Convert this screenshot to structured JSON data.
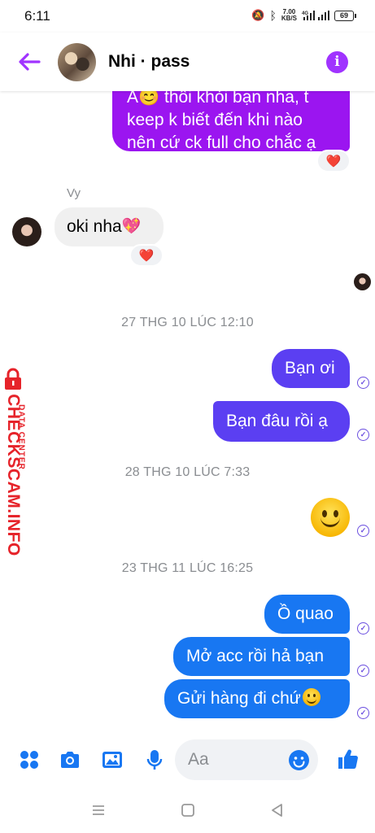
{
  "status_bar": {
    "time": "6:11",
    "speed_value": "7.00",
    "speed_unit": "KB/S",
    "battery": "69"
  },
  "header": {
    "contact_name": "Nhi · pass"
  },
  "messages": {
    "first_out": {
      "line1": "A😊 thôi khỏi bạn nha, t",
      "line2": "keep k biết đến khi nào",
      "line3": "nên cứ ck full cho chắc ạ",
      "reaction": "❤️"
    },
    "incoming": {
      "sender": "Vy",
      "text": "oki nha",
      "emoji": "💖",
      "reaction": "❤️"
    },
    "time_1": "27 THG 10 LÚC 12:10",
    "out_1": "Bạn ơi",
    "out_2": "Bạn đâu rồi ạ",
    "time_2": "28 THG 10 LÚC 7:33",
    "time_3": "23 THG 11 LÚC 16:25",
    "out_3": "Ồ quao",
    "out_4": "Mở acc rồi hả bạn",
    "out_5": "Gửi hàng đi chứ"
  },
  "watermark": {
    "small": "DATA CENTER",
    "big": "CHECKSCAM.INFO"
  },
  "composer": {
    "placeholder": "Aa"
  },
  "colors": {
    "accent": "#a033ff",
    "bubble_purple": "#9b15f0",
    "bubble_violet": "#5b3ff2",
    "bubble_blue": "#1877f2",
    "watermark_red": "#e6232a"
  }
}
